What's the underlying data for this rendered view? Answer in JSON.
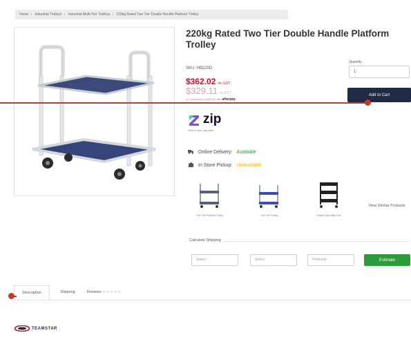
{
  "breadcrumb": [
    "Home",
    "Industrial Trolleys",
    "Industrial Multi-Tier Trolleys",
    "220kg Rated Two Tier Double Handle Platform Trolley"
  ],
  "product": {
    "title": "220kg Rated Two Tier Double Handle Platform Trolley",
    "sku": "SKU: HB220D",
    "price": "$362.02",
    "price_note": "inc GST",
    "price_ex": "$329.11",
    "price_ex_note": "ex GST",
    "afterpay_text": "or 4 payments of $90.51 with",
    "afterpay_brand": "afterpay"
  },
  "purchase": {
    "qty_label": "Quantity",
    "qty_value": "1",
    "add_to_cart": "Add to Cart"
  },
  "zip": {
    "logo": "zip",
    "sub": "Own it now, pay later"
  },
  "availability": {
    "delivery_label": "Online Delivery:",
    "delivery_status": "Available",
    "pickup_label": "In Store Pickup:",
    "pickup_status": "Unavailable"
  },
  "related": {
    "items": [
      {
        "caption": "Two Tier Platform Trolley"
      },
      {
        "caption": "Two Tier Trolley"
      },
      {
        "caption": "Heavy Duty Utility Cart"
      }
    ],
    "view_similar": "View Similar Products"
  },
  "shipping": {
    "label": "Calculate Shipping",
    "country_placeholder": "Select",
    "state_placeholder": "Select",
    "postcode_placeholder": "Postcode",
    "estimate_button": "Estimate"
  },
  "tabs": {
    "description": "Description",
    "shipping": "Shipping",
    "reviews": "Reviews"
  },
  "brand": {
    "name": "TEAMSTAR"
  },
  "colors": {
    "accent_red": "#c8102e",
    "cart_navy": "#1f2a44",
    "estimate_green": "#2e9b3a",
    "annotation_red": "#c0392b"
  }
}
